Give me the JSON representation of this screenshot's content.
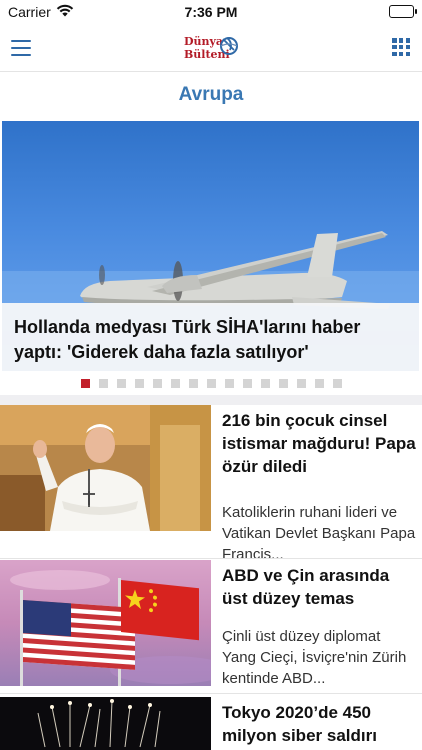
{
  "status_bar": {
    "carrier": "Carrier",
    "time": "7:36 PM"
  },
  "header": {
    "logo_line1": "Dünya",
    "logo_line2": "Bülteni",
    "menu_icon": "hamburger-menu-icon",
    "grid_icon": "grid-icon"
  },
  "section": {
    "title": "Avrupa"
  },
  "hero": {
    "title": "Hollanda medyası Türk SİHA'larını haber yaptı: 'Giderek daha fazla satılıyor'",
    "page_count": 15,
    "active_page": 1
  },
  "news": [
    {
      "title": "216 bin çocuk cinsel istismar mağduru! Papa özür diledi",
      "summary": "Katoliklerin ruhani lideri ve Vatikan Devlet Başkanı Papa Francis..."
    },
    {
      "title": "ABD ve Çin arasında üst düzey temas",
      "summary": "Çinli üst düzey diplomat Yang Cieçi, İsviçre'nin Zürih kentinde ABD..."
    },
    {
      "title": "Tokyo 2020’de 450 milyon siber saldırı"
    }
  ],
  "colors": {
    "accent": "#2f69a7",
    "brand": "#b31b27",
    "active_dot": "#c2202b"
  }
}
